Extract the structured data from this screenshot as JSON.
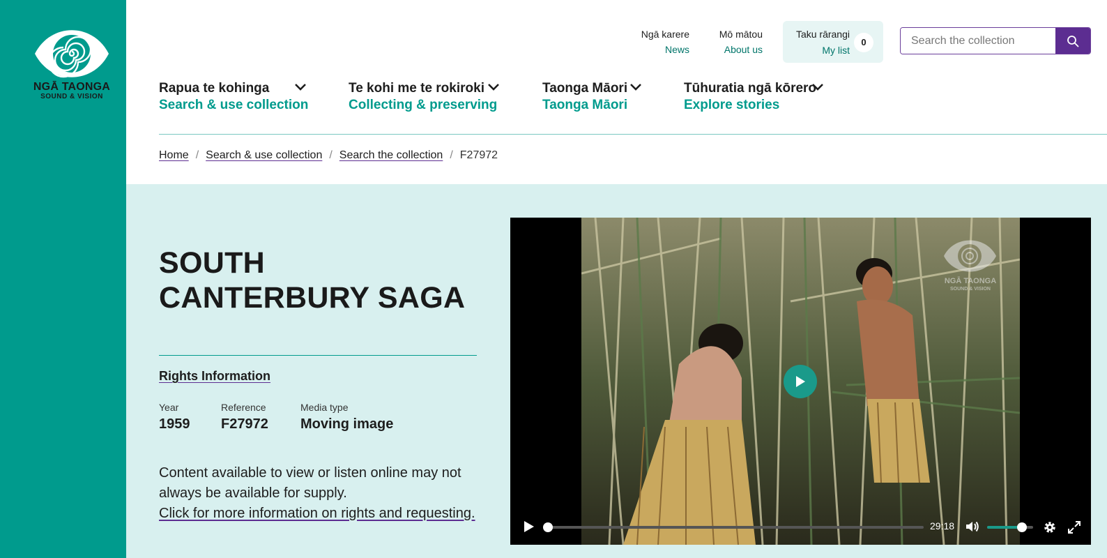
{
  "brand": {
    "name": "NGĀ TAONGA",
    "subtitle": "SOUND & VISION",
    "watermark_name": "NGĀ TAONGA",
    "watermark_sub": "SOUND & VISION",
    "sidebar_color": "#009b8d",
    "accent_purple": "#5c2d91"
  },
  "utility_nav": {
    "news": {
      "mi": "Ngā karere",
      "en": "News"
    },
    "about": {
      "mi": "Mō mātou",
      "en": "About us"
    },
    "mylist": {
      "mi": "Taku rārangi",
      "en": "My list",
      "count": "0"
    }
  },
  "search": {
    "placeholder": "Search the collection",
    "icon": "search-icon"
  },
  "main_nav": [
    {
      "mi": "Rapua te kohinga",
      "en": "Search & use collection"
    },
    {
      "mi": "Te kohi me te rokiroki",
      "en": "Collecting & preserving"
    },
    {
      "mi": "Taonga Māori",
      "en": "Taonga Māori"
    },
    {
      "mi": "Tūhuratia ngā kōrero",
      "en": "Explore stories"
    }
  ],
  "breadcrumb": {
    "home": "Home",
    "search_use": "Search & use collection",
    "search_collection": "Search the collection",
    "current": "F27972",
    "separator": "/"
  },
  "record": {
    "title": "SOUTH CANTERBURY SAGA",
    "rights_link": "Rights Information",
    "year_label": "Year",
    "year": "1959",
    "reference_label": "Reference",
    "reference": "F27972",
    "media_type_label": "Media type",
    "media_type": "Moving image",
    "notice": "Content available to view or listen online may not always be available for supply.",
    "notice_link": "Click for more information on rights and requesting."
  },
  "player": {
    "duration": "29:18",
    "progress": 0,
    "volume": 0.75
  }
}
